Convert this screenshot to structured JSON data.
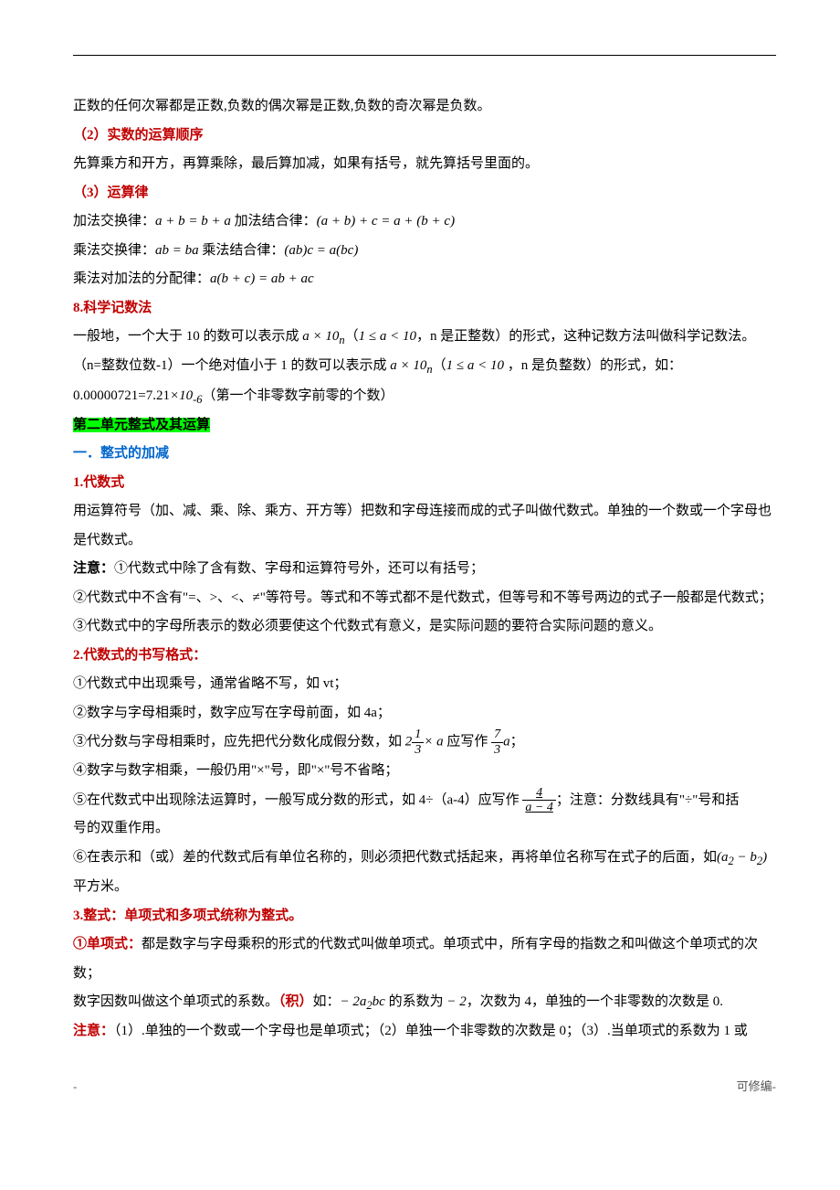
{
  "header_dash": ".",
  "header_dash_r": "-",
  "p1": "正数的任何次幂都是正数,负数的偶次幂是正数,负数的奇次幂是负数。",
  "h2": "（2）实数的运算顺序",
  "p2": "先算乘方和开方，再算乘除，最后算加减，如果有括号，就先算括号里面的。",
  "h3": "（3）运算律",
  "p3a": "加法交换律：",
  "eq3a": "a + b = b + a",
  "p3b": "   加法结合律：",
  "eq3b": "(a + b) + c = a + (b + c)",
  "p4a": "乘法交换律：",
  "eq4a": "ab = ba",
  "p4b": "   乘法结合律：",
  "eq4b": "(ab)c = a(bc)",
  "p5a": "乘法对加法的分配律：",
  "eq5a": "a(b + c) = ab + ac",
  "h8": "8.科学记数法",
  "p6a": "一般地，一个大于 10 的数可以表示成 ",
  "eq6a": "a × 10",
  "eq6an": "n",
  "p6b": "（",
  "eq6b": "1 ≤ a < 10",
  "p6c": "，n 是正整数）的形式，这种记数方法叫做科学记数法。",
  "p7a": "（n=整数位数-1）一个绝对值小于 1 的数可以表示成 ",
  "eq7a": "a × 10",
  "eq7an": "n",
  "p7b": "（",
  "eq7b": "1 ≤ a < 10",
  "p7c": " ，n 是负整数）的形式，如：",
  "p8a": "0.00000721=7.21",
  "eq8a": "×10",
  "eq8b": "-6",
  "p8b": "（第一个非零数字前零的个数）",
  "unit2": "第二单元整式及其运算",
  "sec1": "一．整式的加减",
  "h1_1": "1.代数式",
  "p9": "用运算符号（加、减、乘、除、乘方、开方等）把数和字母连接而成的式子叫做代数式。单独的一个数或一个字母也是代数式。",
  "p10a": "注意：",
  "p10b": "①代数式中除了含有数、字母和运算符号外，还可以有括号；",
  "p11": "②代数式中不含有\"=、>、<、≠\"等符号。等式和不等式都不是代数式，但等号和不等号两边的式子一般都是代数式；",
  "p12": "③代数式中的字母所表示的数必须要使这个代数式有意义，是实际问题的要符合实际问题的意义。",
  "h2_1": "2.代数式的书写格式：",
  "p13": "①代数式中出现乘号，通常省略不写，如 vt；",
  "p14": "②数字与字母相乘时，数字应写在字母前面，如 4a；",
  "p15a": "③代分数与字母相乘时，应先把代分数化成假分数，如 ",
  "fr1w": "2",
  "fr1n": "1",
  "fr1d": "3",
  "p15b": "× a",
  "p15c": " 应写作 ",
  "fr2n": "7",
  "fr2d": "3",
  "p15d": "a",
  "p15e": "；",
  "p16": "④数字与数字相乘，一般仍用\"×\"号，即\"×\"号不省略；",
  "p17a": "⑤在代数式中出现除法运算时，一般写成分数的形式，如 4÷（a-4）应写作 ",
  "fr3n": "4",
  "fr3d": "a − 4",
  "p17b": "；注意：分数线具有\"÷\"号和括",
  "p17c": "号的双重作用。",
  "p18a": "⑥在表示和（或）差的代数式后有单位名称的，则必须把代数式括起来，再将单位名称写在式子的后面，如",
  "eq18": "(a",
  "eq18s": "2",
  "eq18b": " − b",
  "eq18s2": "2",
  "eq18c": ")",
  "p18b": "平方米。",
  "h3_1": "3.整式：单项式和多项式统称为整式。",
  "p19a": "①单项式：",
  "p19b": "都是数字与字母乘积的形式的代数式叫做单项式。单项式中，所有字母的指数之和叫做这个单项式的次数；",
  "p20a": "数字因数叫做这个单项式的系数。",
  "p20b": "（积）",
  "p20c": "如：",
  "eq20": "− 2a",
  "eq20s": "2",
  "eq20b": "bc",
  "p20d": " 的系数为 ",
  "eq20c": "− 2",
  "p20e": "，次数为 4，单独的一个非零数的次数是 0.",
  "p21a": "注意：",
  "p21b": "（1）.单独的一个数或一个字母也是单项式；（2）单独一个非零数的次数是 0；（3）.当单项式的系数为 1 或",
  "footer_l": "-",
  "footer_r": "可修编-"
}
